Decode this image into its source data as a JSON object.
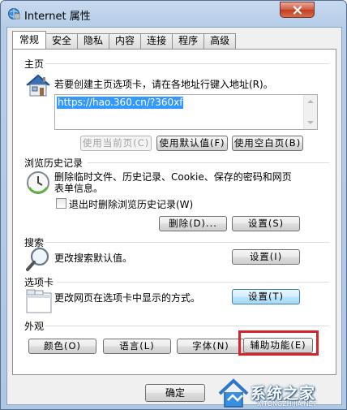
{
  "window": {
    "title": "Internet 属性"
  },
  "tabs": [
    {
      "label": "常规",
      "active": true
    },
    {
      "label": "安全"
    },
    {
      "label": "隐私"
    },
    {
      "label": "内容"
    },
    {
      "label": "连接"
    },
    {
      "label": "程序"
    },
    {
      "label": "高级"
    }
  ],
  "home": {
    "title": "主页",
    "description": "若要创建主页选项卡，请在各地址行键入地址(R)。",
    "url": "https://hao.360.cn/?360xf",
    "buttons": {
      "current": "使用当前页(C)",
      "default": "使用默认值(F)",
      "blank": "使用空白页(B)"
    }
  },
  "history": {
    "title": "浏览历史记录",
    "description_line1": "删除临时文件、历史记录、Cookie、保存的密码和网页",
    "description_line2": "表单信息。",
    "checkbox_label": "退出时删除浏览历史记录(W)",
    "checkbox_checked": false,
    "buttons": {
      "delete": "删除(D)...",
      "settings": "设置(S)"
    }
  },
  "search": {
    "title": "搜索",
    "description": "更改搜索默认值。",
    "settings_label": "设置(I)"
  },
  "tabs_section": {
    "title": "选项卡",
    "description": "更改网页在选项卡中显示的方式。",
    "settings_label": "设置(T)"
  },
  "appearance": {
    "title": "外观",
    "buttons": {
      "colors": "颜色(O)",
      "languages": "语言(L)",
      "fonts": "字体(N)",
      "accessibility": "辅助功能(E)"
    }
  },
  "footer": {
    "ok_label": "确定"
  },
  "watermark": {
    "text": "系统之家",
    "url": "XITONGZHIJIA.NET"
  },
  "colors": {
    "highlight": "#d9232b",
    "selection": "#3399ff"
  }
}
